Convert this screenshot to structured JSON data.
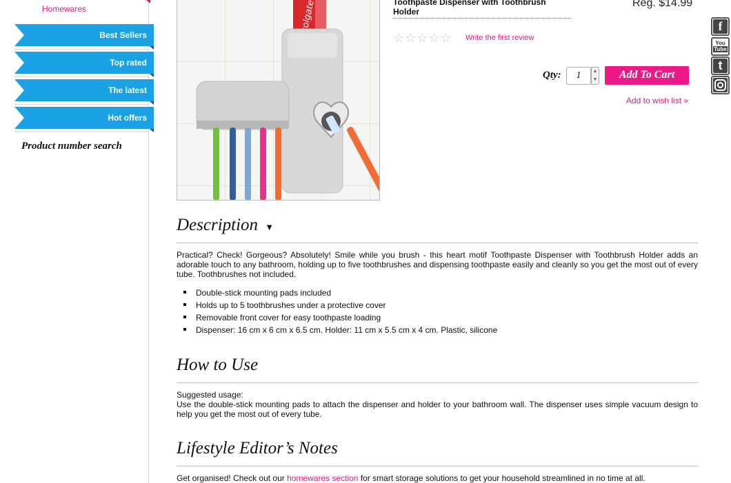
{
  "sidebar": {
    "homewares_link": "Homewares",
    "nav": [
      "Best Sellers",
      "Top rated",
      "The latest",
      "Hot offers"
    ],
    "product_number_search": "Product number search"
  },
  "product": {
    "title_line1": "Toothpaste Dispenser with Toothbrush",
    "title_line2": "Holder",
    "reg_price": "Reg. $14.99",
    "stars": "☆☆☆☆☆",
    "review_link": "Write the first review",
    "qty_label": "Qty:",
    "qty_value": "1",
    "add_to_cart": "Add To Cart",
    "wishlist": "Add to wish list »",
    "image_brand_text": "colgate"
  },
  "social": [
    "facebook-icon",
    "youtube-icon",
    "twitter-icon",
    "instagram-icon"
  ],
  "description": {
    "title": "Description",
    "toggle": "▼",
    "text": "Practical? Check! Gorgeous? Absolutely! Smile while you brush - this heart motif Toothpaste Dispenser with Toothbrush Holder adds an adorable touch to any bathroom, holding up to five toothbrushes and dispensing toothpaste easily and cleanly so you get the most out of every tube. Toothbrushes not included.",
    "bullets": [
      "Double-stick mounting pads included",
      "Holds up to 5 toothbrushes under a protective cover",
      "Removable front cover for easy toothpaste loading",
      "Dispenser: 16 cm x 6 cm x 6.5 cm. Holder: 11 cm x 5.5 cm x 4 cm. Plastic, silicone"
    ]
  },
  "how_to_use": {
    "title": "How to Use",
    "line1": "Suggested usage:",
    "line2": "Use the double-stick mounting pads to attach the dispenser and holder to your bathroom wall. The dispenser uses simple vacuum design to help you get the most out of every tube."
  },
  "editor_notes": {
    "title": "Lifestyle Editor’s Notes",
    "before_link": "Get organised! Check out our ",
    "link": "homewares section",
    "after_link": " for smart storage solutions to get your household streamlined in no time at all."
  }
}
